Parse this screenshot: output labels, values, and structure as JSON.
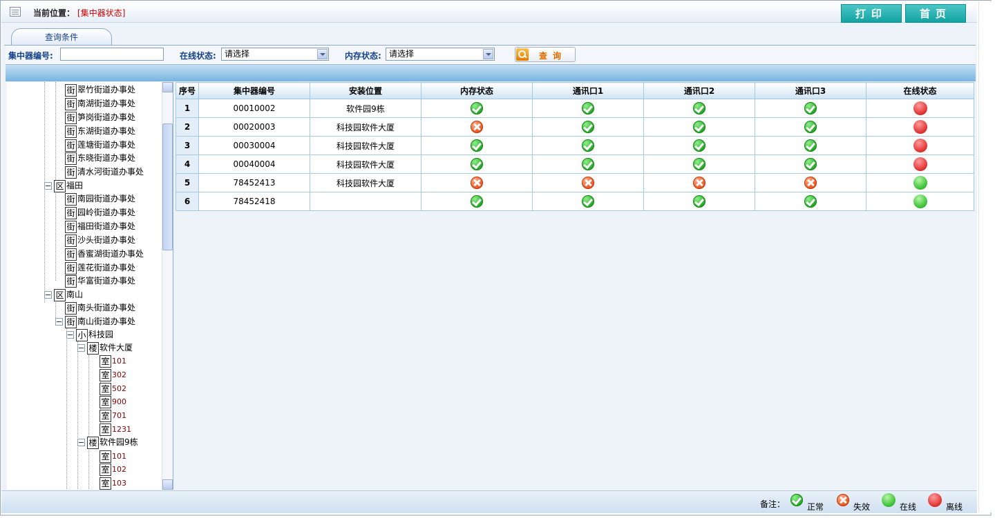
{
  "header": {
    "location_label": "当前位置：",
    "location_open": "[",
    "location_value": "集中器状态",
    "location_close": "]",
    "print_label": "打印",
    "home_label": "首页"
  },
  "query": {
    "tab_label": "查询条件",
    "concentrator_no_label": "集中器编号:",
    "concentrator_no_value": "",
    "online_label": "在线状态:",
    "online_value": "请选择",
    "memory_label": "内存状态:",
    "memory_value": "请选择",
    "search_label": "查询"
  },
  "tree": {
    "rows": [
      {
        "icon": "街",
        "label": "翠竹街道办事处"
      },
      {
        "icon": "街",
        "label": "南湖街道办事处"
      },
      {
        "icon": "街",
        "label": "笋岗街道办事处"
      },
      {
        "icon": "街",
        "label": "东湖街道办事处"
      },
      {
        "icon": "街",
        "label": "莲塘街道办事处"
      },
      {
        "icon": "街",
        "label": "东晓街道办事处"
      },
      {
        "icon": "街",
        "label": "清水河街道办事处"
      },
      {
        "icon": "区",
        "label": "福田"
      },
      {
        "icon": "街",
        "label": "南园街道办事处"
      },
      {
        "icon": "街",
        "label": "园岭街道办事处"
      },
      {
        "icon": "街",
        "label": "福田街道办事处"
      },
      {
        "icon": "街",
        "label": "沙头街道办事处"
      },
      {
        "icon": "街",
        "label": "香蜜湖街道办事处"
      },
      {
        "icon": "街",
        "label": "莲花街道办事处"
      },
      {
        "icon": "街",
        "label": "华富街道办事处"
      },
      {
        "icon": "区",
        "label": "南山"
      },
      {
        "icon": "街",
        "label": "南头街道办事处"
      },
      {
        "icon": "街",
        "label": "南山街道办事处"
      },
      {
        "icon": "小",
        "label": "科技园"
      },
      {
        "icon": "楼",
        "label": "软件大厦"
      },
      {
        "icon": "室",
        "label": "101"
      },
      {
        "icon": "室",
        "label": "302"
      },
      {
        "icon": "室",
        "label": "502"
      },
      {
        "icon": "室",
        "label": "900"
      },
      {
        "icon": "室",
        "label": "701"
      },
      {
        "icon": "室",
        "label": "1231"
      },
      {
        "icon": "楼",
        "label": "软件园9栋"
      },
      {
        "icon": "室",
        "label": "101"
      },
      {
        "icon": "室",
        "label": "102"
      },
      {
        "icon": "室",
        "label": "103"
      }
    ]
  },
  "table": {
    "headers": [
      "序号",
      "集中器编号",
      "安装位置",
      "内存状态",
      "通讯口1",
      "通讯口2",
      "通讯口3",
      "在线状态"
    ],
    "rows": [
      {
        "no": "1",
        "id": "00010002",
        "location": "软件园9栋",
        "memory": "ok",
        "port1": "ok",
        "port2": "ok",
        "port3": "ok",
        "online": "offline"
      },
      {
        "no": "2",
        "id": "00020003",
        "location": "科技园软件大厦",
        "memory": "fail",
        "port1": "ok",
        "port2": "ok",
        "port3": "ok",
        "online": "offline"
      },
      {
        "no": "3",
        "id": "00030004",
        "location": "科技园软件大厦",
        "memory": "ok",
        "port1": "ok",
        "port2": "ok",
        "port3": "ok",
        "online": "offline"
      },
      {
        "no": "4",
        "id": "00040004",
        "location": "科技园软件大厦",
        "memory": "ok",
        "port1": "ok",
        "port2": "ok",
        "port3": "ok",
        "online": "offline"
      },
      {
        "no": "5",
        "id": "78452413",
        "location": "科技园软件大厦",
        "memory": "fail",
        "port1": "fail",
        "port2": "fail",
        "port3": "fail",
        "online": "online"
      },
      {
        "no": "6",
        "id": "78452418",
        "location": "",
        "memory": "ok",
        "port1": "ok",
        "port2": "ok",
        "port3": "ok",
        "online": "online"
      }
    ]
  },
  "legend": {
    "label": "备注：",
    "normal": "正常",
    "failed": "失效",
    "online": "在线",
    "offline": "离线"
  },
  "icons": {
    "ok": "check-circle-icon",
    "fail": "x-circle-icon",
    "online": "green-dot-icon",
    "offline": "red-dot-icon"
  },
  "colors": {
    "accent_teal": "#14a3a3",
    "location_red": "#cc0000",
    "label_blue": "#15428b",
    "ok_green": "#23a224",
    "fail_orange": "#e8501c",
    "online_green": "#3fc23a",
    "offline_red": "#e23636"
  }
}
